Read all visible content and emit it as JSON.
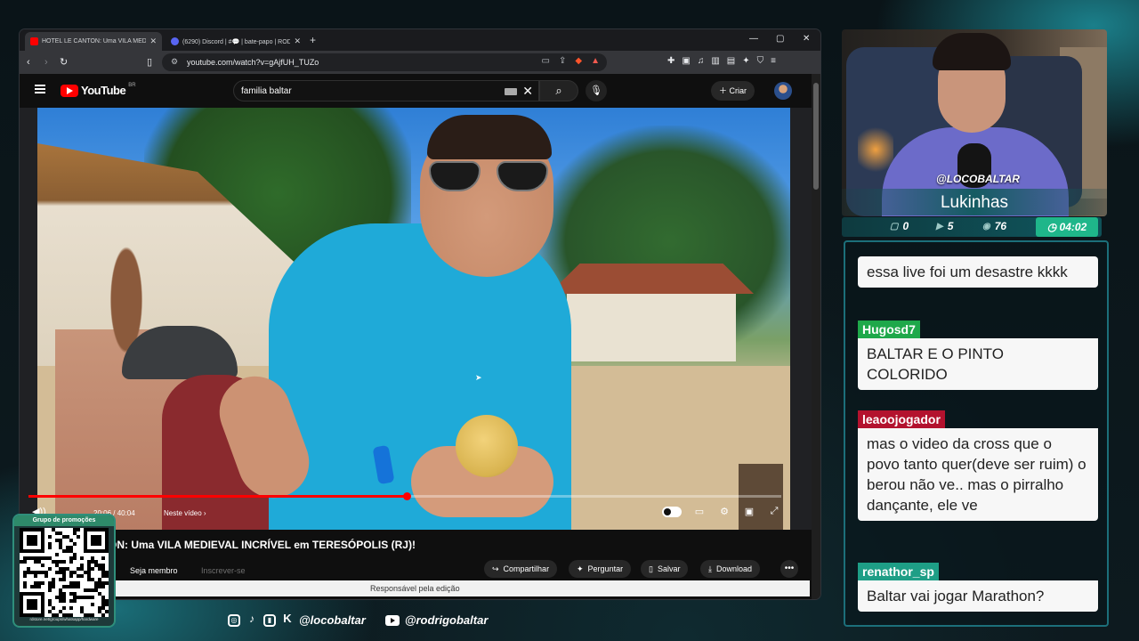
{
  "browser": {
    "tabs": [
      {
        "title": "HOTEL LE CANTON: Uma VILA MED",
        "active": true,
        "favicon_color": "#ff0000"
      },
      {
        "title": "(6290) Discord | #💬 | bate-papo | RODRIGO",
        "active": false,
        "favicon_color": "#5865f2"
      }
    ],
    "new_tab": "+",
    "url": "youtube.com/watch?v=gAjfUH_TUZo",
    "window_controls": {
      "minimize": "—",
      "maximize": "▢",
      "close": "✕"
    }
  },
  "youtube": {
    "logo_text": "YouTube",
    "region": "BR",
    "search_query": "familia baltar",
    "create_label": "Criar",
    "player": {
      "current_time": "20:06",
      "duration": "40:04",
      "time_label": "20:06 / 40:04",
      "chapter": "Neste vídeo",
      "progress": 0.502
    },
    "video_title": "ON: Uma VILA MEDIEVAL INCRÍVEL em TERESÓPOLIS (RJ)!",
    "join_label": "Seja membro",
    "subscribe_label": "Inscrever-se",
    "actions": {
      "share": "Compartilhar",
      "ask": "Perguntar",
      "save": "Salvar",
      "download": "Download",
      "more": "•••"
    },
    "edit_banner": "Responsável pela edição"
  },
  "qr": {
    "label": "Grupo de promoções",
    "url": "rdstore.net/groups/whatsapp/hardware"
  },
  "socials": {
    "handle_1": "@locobaltar",
    "handle_2": "@rodrigobaltar"
  },
  "webcam": {
    "tag": "@LOCOBALTAR",
    "display_name": "Lukinhas",
    "stats": {
      "chat": "0",
      "video": "5",
      "viewers": "76",
      "timer": "04:02"
    }
  },
  "chat": [
    {
      "user": "",
      "text": "essa live foi um desastre kkkk",
      "user_color": ""
    },
    {
      "user": "Hugosd7",
      "text": "BALTAR E O PINTO COLORIDO",
      "user_color": "#1fa84a"
    },
    {
      "user": "leaoojogador",
      "text": "mas o video da cross que o povo tanto quer(deve ser ruim) o berou não ve.. mas o pirralho dançante, ele ve",
      "user_color": "#b3122e"
    },
    {
      "user": "renathor_sp",
      "text": "Baltar vai jogar Marathon?",
      "user_color": "#1e9e86"
    }
  ]
}
